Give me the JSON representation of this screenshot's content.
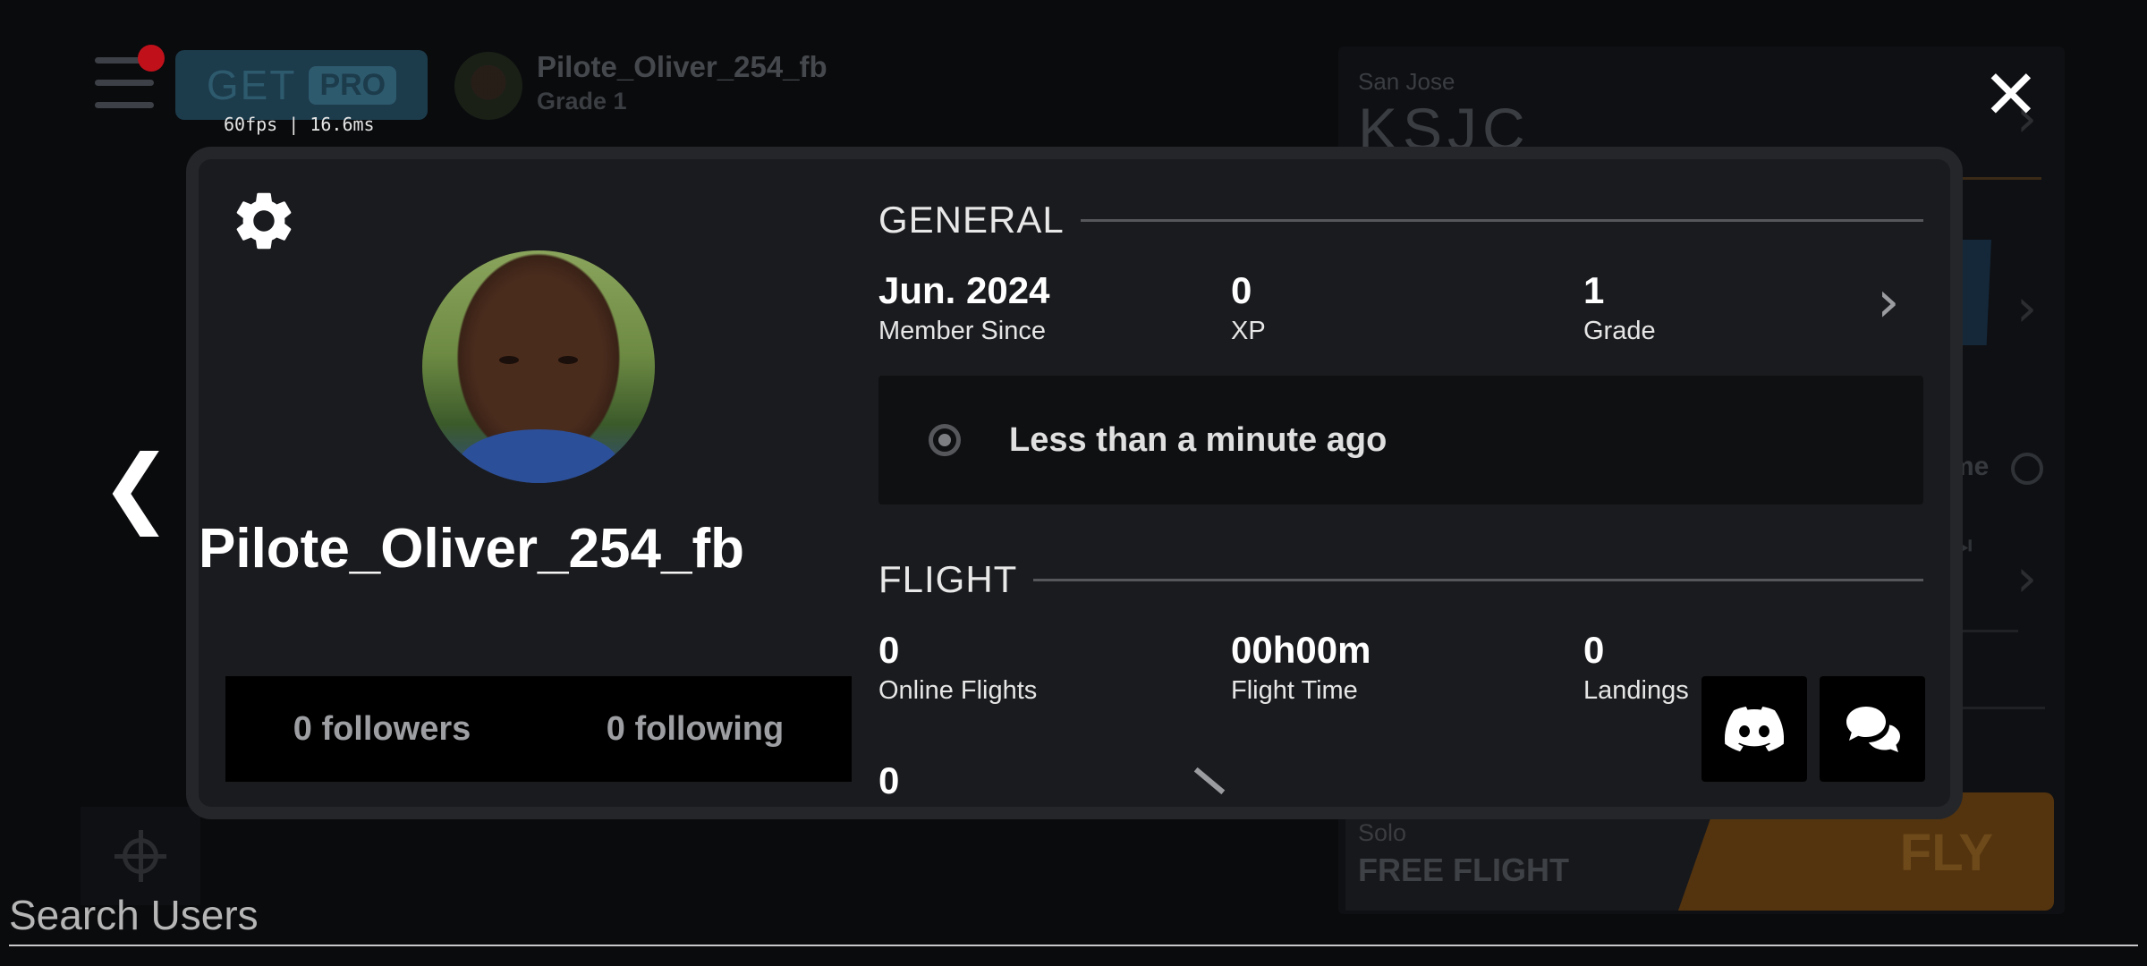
{
  "topbar": {
    "pro_button": {
      "get": "GET",
      "pro": "PRO"
    },
    "fps": "60fps | 16.6ms",
    "user": {
      "name": "Pilote_Oliver_254_fb",
      "grade": "Grade 1"
    }
  },
  "right_panel": {
    "city": "San Jose",
    "airport_code": "KSJC",
    "partial_label": "me",
    "mode": "Solo",
    "flight_type": "FREE FLIGHT",
    "fly_label": "FLY"
  },
  "search": {
    "placeholder": "Search Users",
    "value": ""
  },
  "profile": {
    "username": "Pilote_Oliver_254_fb",
    "followers": "0 followers",
    "following": "0 following",
    "general": {
      "title": "GENERAL",
      "stats": [
        {
          "value": "Jun. 2024",
          "label": "Member Since"
        },
        {
          "value": "0",
          "label": "XP"
        },
        {
          "value": "1",
          "label": "Grade"
        }
      ],
      "last_seen": "Less than a minute ago"
    },
    "flight": {
      "title": "FLIGHT",
      "stats": [
        {
          "value": "0",
          "label": "Online Flights"
        },
        {
          "value": "00h00m",
          "label": "Flight Time"
        },
        {
          "value": "0",
          "label": "Landings"
        }
      ],
      "partial_value": "0"
    }
  },
  "icons": {
    "settings": "gear-icon",
    "close": "close-icon",
    "back": "chevron-left-icon",
    "discord": "discord-icon",
    "chat": "chat-icon"
  }
}
